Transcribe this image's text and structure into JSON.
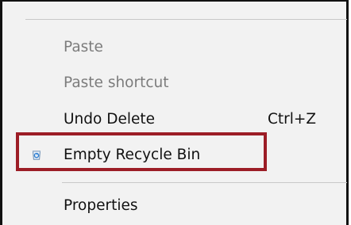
{
  "context_menu": {
    "items": [
      {
        "label": "Paste",
        "shortcut": "",
        "enabled": false
      },
      {
        "label": "Paste shortcut",
        "shortcut": "",
        "enabled": false
      },
      {
        "label": "Undo Delete",
        "shortcut": "Ctrl+Z",
        "enabled": true
      },
      {
        "label": "Empty Recycle Bin",
        "shortcut": "",
        "enabled": true,
        "icon": "recycle-bin-icon",
        "highlighted": true
      },
      {
        "label": "Properties",
        "shortcut": "",
        "enabled": true
      }
    ]
  },
  "colors": {
    "highlight_border": "#9c1d26",
    "disabled_text": "#7c7c7c",
    "text": "#111111",
    "menu_background": "#f2f2f2"
  }
}
